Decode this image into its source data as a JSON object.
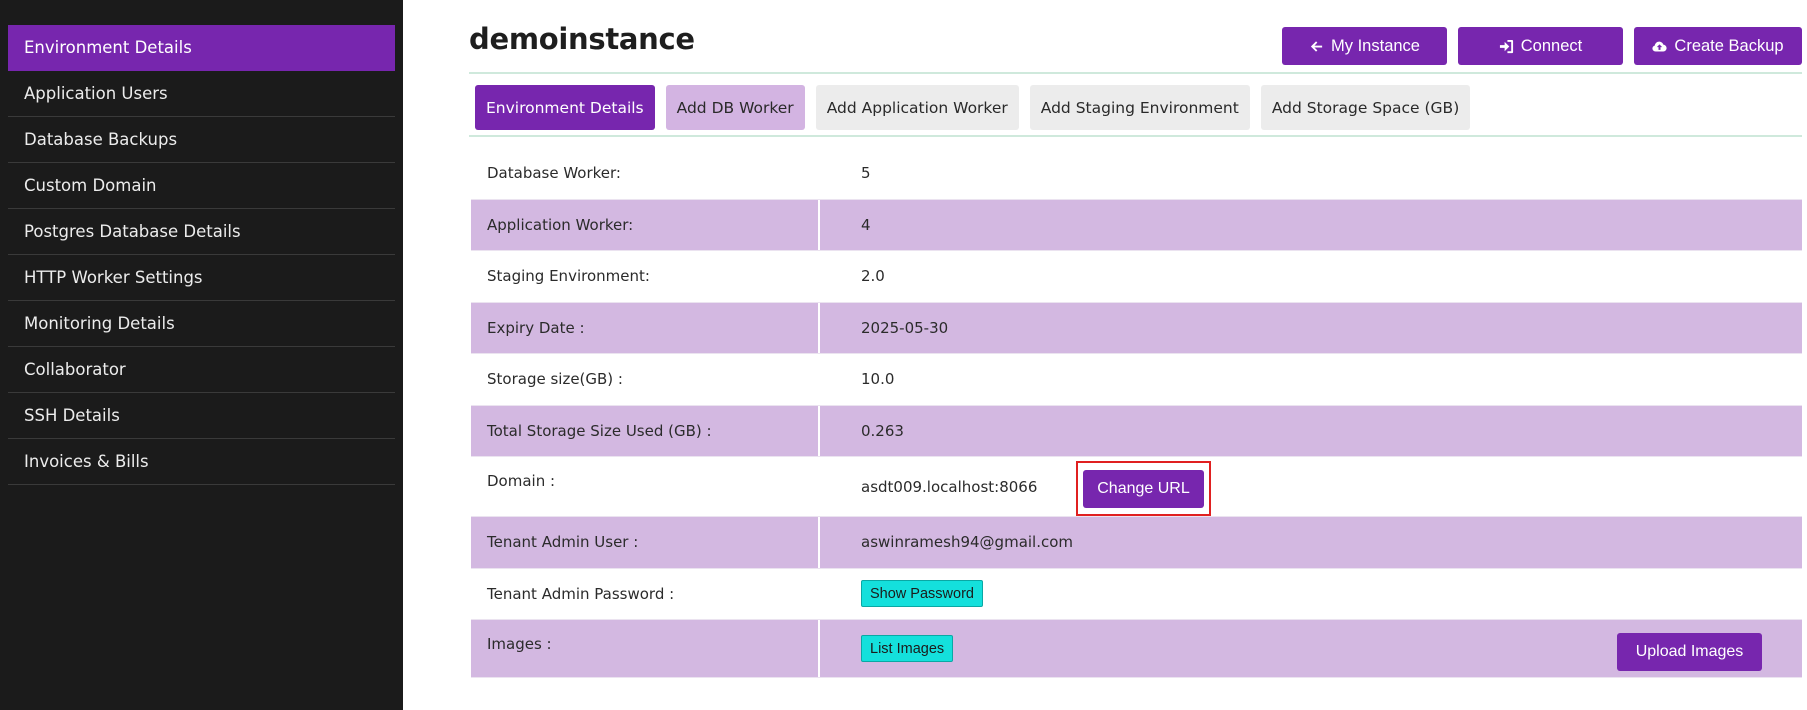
{
  "sidebar": {
    "items": [
      {
        "label": "Environment Details",
        "active": true
      },
      {
        "label": "Application Users"
      },
      {
        "label": "Database Backups"
      },
      {
        "label": "Custom Domain"
      },
      {
        "label": "Postgres Database Details"
      },
      {
        "label": "HTTP Worker Settings"
      },
      {
        "label": "Monitoring Details"
      },
      {
        "label": "Collaborator"
      },
      {
        "label": "SSH Details"
      },
      {
        "label": "Invoices & Bills"
      }
    ]
  },
  "header": {
    "title": "demoinstance",
    "actions": {
      "my_instance": "My Instance",
      "connect": "Connect",
      "create_backup": "Create Backup"
    }
  },
  "tabs": [
    {
      "label": "Environment Details",
      "state": "active"
    },
    {
      "label": "Add DB Worker",
      "state": "hover"
    },
    {
      "label": "Add Application Worker"
    },
    {
      "label": "Add Staging Environment"
    },
    {
      "label": "Add Storage Space (GB)"
    }
  ],
  "details": {
    "db_worker": {
      "label": "Database Worker:",
      "value": "5"
    },
    "app_worker": {
      "label": "Application Worker:",
      "value": "4"
    },
    "staging": {
      "label": "Staging Environment:",
      "value": "2.0"
    },
    "expiry": {
      "label": "Expiry Date :",
      "value": "2025-05-30"
    },
    "storage": {
      "label": "Storage size(GB) :",
      "value": "10.0"
    },
    "storage_used": {
      "label": "Total Storage Size Used (GB) :",
      "value": "0.263"
    },
    "domain": {
      "label": "Domain :",
      "value": "asdt009.localhost:8066",
      "button": "Change URL"
    },
    "tenant_user": {
      "label": "Tenant Admin User :",
      "value": "aswinramesh94@gmail.com"
    },
    "tenant_password": {
      "label": "Tenant Admin Password :",
      "button": "Show Password"
    },
    "images": {
      "label": "Images :",
      "list_button": "List Images",
      "upload_button": "Upload Images"
    }
  },
  "colors": {
    "accent": "#7726ae",
    "row_alt": "#d3b8e1",
    "teal_button": "#14e0dc",
    "highlight_border": "#e02020",
    "sidebar_bg": "#1b1b1b"
  }
}
